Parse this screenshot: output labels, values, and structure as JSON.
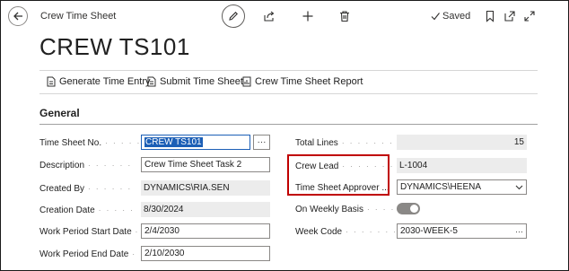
{
  "header": {
    "breadcrumb": "Crew Time Sheet",
    "saved_label": "Saved",
    "page_title": "CREW TS101"
  },
  "actions": [
    {
      "label": "Generate Time Entry"
    },
    {
      "label": "Submit Time Sheet"
    },
    {
      "label": "Crew Time Sheet Report"
    }
  ],
  "section": {
    "title": "General"
  },
  "left_fields": {
    "time_sheet_no": {
      "label": "Time Sheet No.",
      "value": "CREW TS101"
    },
    "description": {
      "label": "Description",
      "value": "Crew Time Sheet Task 2"
    },
    "created_by": {
      "label": "Created By",
      "value": "DYNAMICS\\RIA.SEN"
    },
    "creation_date": {
      "label": "Creation Date",
      "value": "8/30/2024"
    },
    "work_start": {
      "label": "Work Period Start Date",
      "value": "2/4/2030"
    },
    "work_end": {
      "label": "Work Period End Date",
      "value": "2/10/2030"
    }
  },
  "right_fields": {
    "total_lines": {
      "label": "Total Lines",
      "value": "15"
    },
    "crew_lead": {
      "label": "Crew Lead",
      "value": "L-1004"
    },
    "approver": {
      "label": "Time Sheet Approver ...",
      "value": "DYNAMICS\\HEENA"
    },
    "weekly_basis": {
      "label": "On Weekly Basis",
      "value": "true"
    },
    "week_code": {
      "label": "Week Code",
      "value": "2030-WEEK-5"
    }
  },
  "colors": {
    "accent": "#1c5fb6",
    "highlight_box": "#c00000"
  }
}
